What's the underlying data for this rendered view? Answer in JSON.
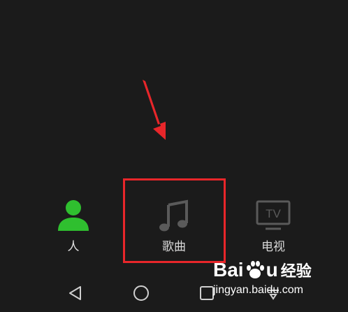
{
  "tabs": [
    {
      "id": "people",
      "label": "人",
      "icon": "person-icon",
      "color": "#2fbf2f"
    },
    {
      "id": "songs",
      "label": "歌曲",
      "icon": "music-note-icon",
      "color": "#5a5a5a"
    },
    {
      "id": "tv",
      "label": "电视",
      "icon": "tv-icon",
      "color": "#5a5a5a"
    }
  ],
  "tv_icon_text": "TV",
  "highlight_color": "#e8262a",
  "navbar": {
    "buttons": [
      "back-icon",
      "home-icon",
      "recent-apps-icon",
      "menu-icon"
    ]
  },
  "watermark": {
    "brand_left": "Bai",
    "brand_right": "u",
    "brand_cn": "经验",
    "url": "jingyan.baidu.com"
  }
}
